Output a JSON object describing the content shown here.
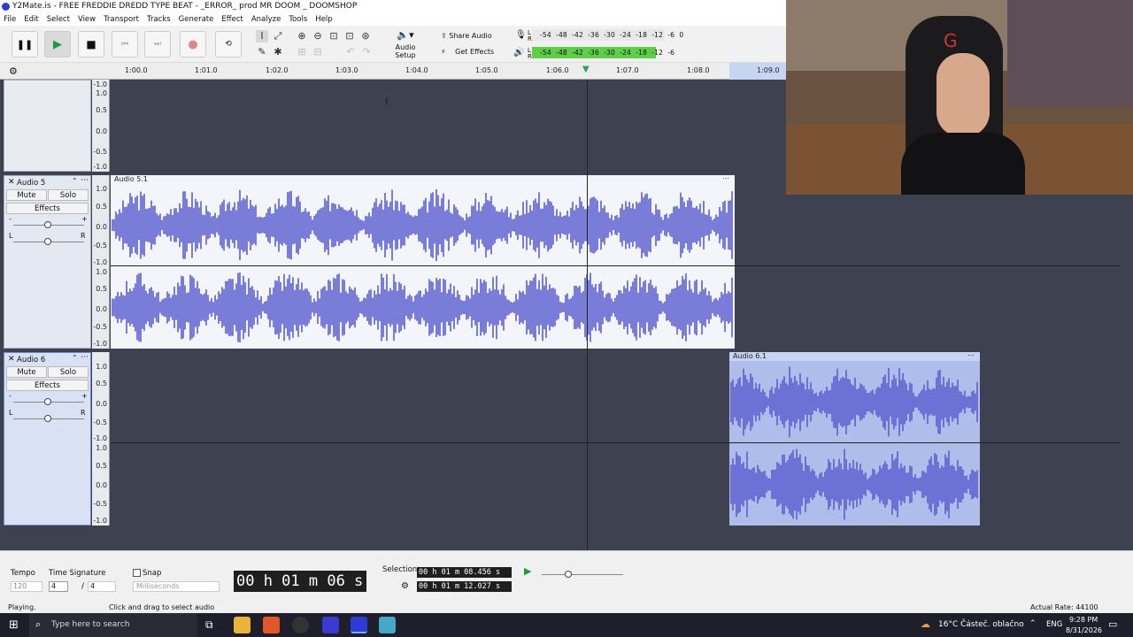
{
  "title": "Y2Mate.is - FREE FREDDIE DREDD TYPE BEAT - _ERROR_ prod MR DOOM _ DOOMSHOP",
  "menu": [
    "File",
    "Edit",
    "Select",
    "View",
    "Transport",
    "Tracks",
    "Generate",
    "Effect",
    "Analyze",
    "Tools",
    "Help"
  ],
  "toolbar": {
    "audio_setup": "Audio Setup",
    "share_audio": "Share Audio",
    "get_effects": "Get Effects",
    "meter_labels": [
      "-54",
      "-48",
      "-42",
      "-36",
      "-30",
      "-24",
      "-18",
      "-12",
      "-6",
      "0"
    ],
    "meter_rec_label": "R",
    "meter_play_label": "L"
  },
  "ruler": {
    "ticks": [
      "1:00.0",
      "1:01.0",
      "1:02.0",
      "1:03.0",
      "1:04.0",
      "1:05.0",
      "1:06.0",
      "1:07.0",
      "1:08.0",
      "1:09.0"
    ]
  },
  "tracks": [
    {
      "name": "",
      "clip": "",
      "scale": [
        "1.0",
        "0.5",
        "0.0",
        "-0.5",
        "-1.0"
      ]
    },
    {
      "name": "Audio 5",
      "clip": "Audio 5.1",
      "mute": "Mute",
      "solo": "Solo",
      "effects": "Effects",
      "gain_left": "-",
      "gain_right": "+",
      "pan_left": "L",
      "pan_right": "R",
      "scale": [
        "1.0",
        "0.5",
        "0.0",
        "-0.5",
        "-1.0"
      ]
    },
    {
      "name": "Audio 6",
      "clip": "Audio 6.1",
      "mute": "Mute",
      "solo": "Solo",
      "effects": "Effects",
      "gain_left": "-",
      "gain_right": "+",
      "pan_left": "L",
      "pan_right": "R",
      "scale": [
        "1.0",
        "0.5",
        "0.0",
        "-0.5",
        "-1.0"
      ]
    }
  ],
  "bottom": {
    "tempo_label": "Tempo",
    "tempo_value": "120",
    "time_sig_label": "Time Signature",
    "time_sig_num": "4",
    "time_sig_den": "4",
    "snap_label": "Snap",
    "snap_unit": "Milliseconds",
    "time_display": "00 h 01 m 06 s",
    "selection_label": "Selection",
    "selection_start": "00 h 01 m 08.456 s",
    "selection_end": "00 h 01 m 12.027 s"
  },
  "status": {
    "left": "Playing.",
    "middle": "Click and drag to select audio",
    "right": "Actual Rate: 44100"
  },
  "taskbar": {
    "search_placeholder": "Type here to search",
    "weather": "16°C  Částeč. oblačno",
    "lang": "ENG",
    "time": "9:28 PM",
    "date": "8/31/2026"
  },
  "colors": {
    "waveform": "#5b5fd0",
    "meter": "#7ecf6a",
    "selected_clip": "#aebde9"
  }
}
